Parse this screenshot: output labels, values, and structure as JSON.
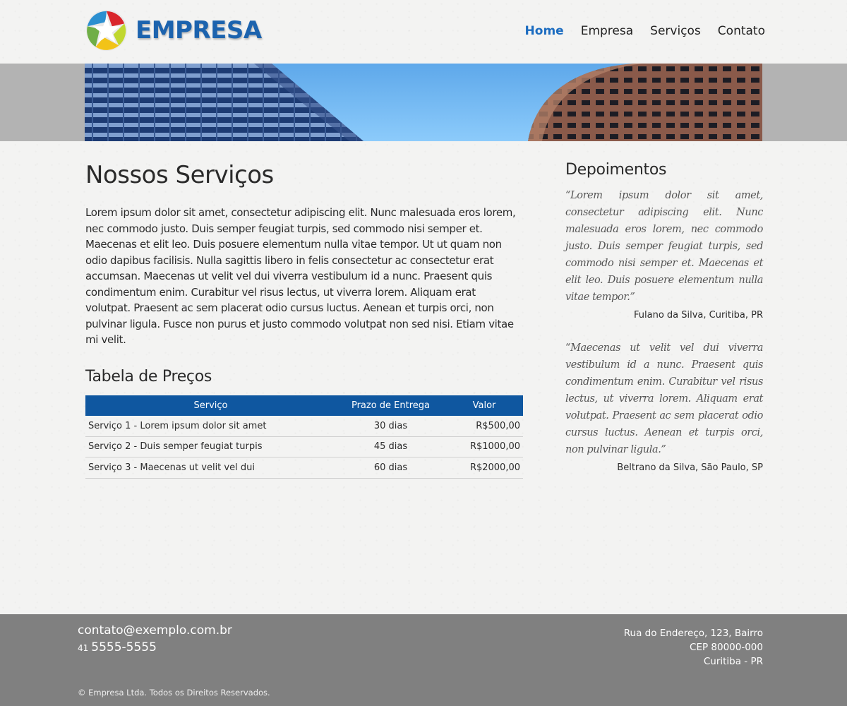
{
  "brand": {
    "name": "EMPRESA"
  },
  "nav": {
    "items": [
      {
        "label": "Home",
        "active": true
      },
      {
        "label": "Empresa",
        "active": false
      },
      {
        "label": "Serviços",
        "active": false
      },
      {
        "label": "Contato",
        "active": false
      }
    ]
  },
  "main": {
    "title": "Nossos Serviços",
    "intro": "Lorem ipsum dolor sit amet, consectetur adipiscing elit. Nunc malesuada eros lorem, nec commodo justo. Duis semper feugiat turpis, sed commodo nisi semper et. Maecenas et elit leo. Duis posuere elementum nulla vitae tempor. Ut ut quam non odio dapibus facilisis. Nulla sagittis libero in felis consectetur ac consectetur erat accumsan. Maecenas ut velit vel dui viverra vestibulum id a nunc. Praesent quis condimentum enim. Curabitur vel risus lectus, ut viverra lorem. Aliquam erat volutpat. Praesent ac sem placerat odio cursus luctus. Aenean et turpis orci, non pulvinar ligula. Fusce non purus et justo commodo volutpat non sed nisi. Etiam vitae mi velit.",
    "prices": {
      "title": "Tabela de Preços",
      "headers": [
        "Serviço",
        "Prazo de Entrega",
        "Valor"
      ],
      "rows": [
        [
          "Serviço 1 - Lorem ipsum dolor sit amet",
          "30 dias",
          "R$500,00"
        ],
        [
          "Serviço 2 - Duis semper feugiat turpis",
          "45 dias",
          "R$1000,00"
        ],
        [
          "Serviço 3 - Maecenas ut velit vel dui",
          "60 dias",
          "R$2000,00"
        ]
      ]
    }
  },
  "sidebar": {
    "title": "Depoimentos",
    "testimonials": [
      {
        "quote": "“Lorem ipsum dolor sit amet, consectetur adipiscing elit. Nunc malesuada eros lorem, nec commodo justo. Duis semper feugiat turpis, sed commodo nisi semper et. Maecenas et elit leo. Duis posuere elementum nulla vitae tempor.”",
        "author": "Fulano da Silva, Curitiba, PR"
      },
      {
        "quote": "“Maecenas ut velit vel dui viverra vestibulum id a nunc. Praesent quis condimentum enim. Curabitur vel risus lectus, ut viverra lorem. Aliquam erat volutpat. Praesent ac sem placerat odio cursus luctus. Aenean et turpis orci, non pulvinar ligula.”",
        "author": "Beltrano da Silva, São Paulo, SP"
      }
    ]
  },
  "footer": {
    "email": "contato@exemplo.com.br",
    "phone_ddd": "41",
    "phone": "5555-5555",
    "address": [
      "Rua do Endereço, 123, Bairro",
      "CEP 80000-000",
      "Curitiba - PR"
    ],
    "copyright": "© Empresa Ltda. Todos os Direitos Reservados."
  },
  "colors": {
    "brand_blue": "#1c63ae",
    "nav_active": "#1c6cc0",
    "table_header": "#0f57a0",
    "footer_bg": "#808080"
  },
  "icons": {
    "logo": "star-logo-icon"
  }
}
